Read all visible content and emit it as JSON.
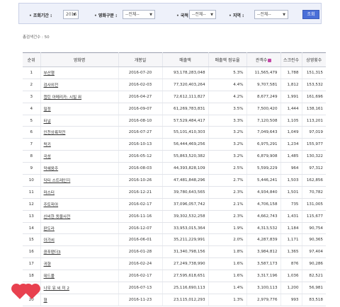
{
  "filters": {
    "period_label": "조회기간 :",
    "year_value": "2016",
    "movie_type_label": "영화구분 :",
    "movie_type_value": "--전체--",
    "country_label": "국적 :",
    "country_value": "--전체--",
    "region_label": "지역 :",
    "region_value": "--전체--",
    "search_label": "조회"
  },
  "total_text": "총검색건수 : 50",
  "table": {
    "headers": {
      "rank": "순위",
      "title": "영화명",
      "release": "개봉일",
      "sales": "매출액",
      "share": "매출액 점유율",
      "audience": "관객수",
      "screens": "스크린수",
      "shows": "상영횟수"
    },
    "rows": [
      {
        "rank": "1",
        "title": "부산행",
        "release": "2016-07-20",
        "sales": "93,178,283,048",
        "share": "5.3%",
        "audience": "11,565,479",
        "screens": "1,788",
        "shows": "151,315"
      },
      {
        "rank": "2",
        "title": "검사외전",
        "release": "2016-02-03",
        "sales": "77,320,403,264",
        "share": "4.4%",
        "audience": "9,707,581",
        "screens": "1,812",
        "shows": "153,532"
      },
      {
        "rank": "3",
        "title": "캡틴 아메리카: 시빌 워",
        "release": "2016-04-27",
        "sales": "72,612,111,827",
        "share": "4.2%",
        "audience": "8,677,249",
        "screens": "1,991",
        "shows": "161,696"
      },
      {
        "rank": "4",
        "title": "밀정",
        "release": "2016-09-07",
        "sales": "61,269,783,831",
        "share": "3.5%",
        "audience": "7,500,420",
        "screens": "1,444",
        "shows": "138,161"
      },
      {
        "rank": "5",
        "title": "터널",
        "release": "2016-08-10",
        "sales": "57,529,484,417",
        "share": "3.3%",
        "audience": "7,120,508",
        "screens": "1,105",
        "shows": "113,201"
      },
      {
        "rank": "6",
        "title": "인천상륙작전",
        "release": "2016-07-27",
        "sales": "55,101,410,303",
        "share": "3.2%",
        "audience": "7,049,643",
        "screens": "1,049",
        "shows": "97,019"
      },
      {
        "rank": "7",
        "title": "럭키",
        "release": "2016-10-13",
        "sales": "56,444,469,256",
        "share": "3.2%",
        "audience": "6,975,291",
        "screens": "1,234",
        "shows": "155,977"
      },
      {
        "rank": "8",
        "title": "곡성",
        "release": "2016-05-12",
        "sales": "55,863,520,382",
        "share": "3.2%",
        "audience": "6,879,908",
        "screens": "1,485",
        "shows": "130,322"
      },
      {
        "rank": "9",
        "title": "덕혜옹주",
        "release": "2016-08-03",
        "sales": "44,393,828,109",
        "share": "2.5%",
        "audience": "5,599,229",
        "screens": "964",
        "shows": "97,312"
      },
      {
        "rank": "10",
        "title": "닥터 스트레인지",
        "release": "2016-10-26",
        "sales": "47,481,848,296",
        "share": "2.7%",
        "audience": "5,446,241",
        "screens": "1,503",
        "shows": "162,856"
      },
      {
        "rank": "11",
        "title": "마스터",
        "release": "2016-12-21",
        "sales": "39,780,643,565",
        "share": "2.3%",
        "audience": "4,934,840",
        "screens": "1,501",
        "shows": "70,782"
      },
      {
        "rank": "12",
        "title": "주토피아",
        "release": "2016-02-17",
        "sales": "37,096,057,742",
        "share": "2.1%",
        "audience": "4,706,158",
        "screens": "735",
        "shows": "131,005"
      },
      {
        "rank": "13",
        "title": "신비한 동물사전",
        "release": "2016-11-16",
        "sales": "39,302,532,258",
        "share": "2.3%",
        "audience": "4,662,743",
        "screens": "1,431",
        "shows": "115,677"
      },
      {
        "rank": "14",
        "title": "판도라",
        "release": "2016-12-07",
        "sales": "33,953,015,364",
        "share": "1.9%",
        "audience": "4,313,532",
        "screens": "1,184",
        "shows": "90,754"
      },
      {
        "rank": "15",
        "title": "아가씨",
        "release": "2016-06-01",
        "sales": "35,211,229,991",
        "share": "2.0%",
        "audience": "4,287,839",
        "screens": "1,171",
        "shows": "90,365"
      },
      {
        "rank": "16",
        "title": "쿵푸팬더3",
        "release": "2016-01-28",
        "sales": "31,340,798,156",
        "share": "1.8%",
        "audience": "3,984,812",
        "screens": "1,365",
        "shows": "97,404"
      },
      {
        "rank": "17",
        "title": "귀향",
        "release": "2016-02-24",
        "sales": "27,249,738,990",
        "share": "1.6%",
        "audience": "3,587,173",
        "screens": "876",
        "shows": "90,286"
      },
      {
        "rank": "18",
        "title": "데드풀",
        "release": "2016-02-17",
        "sales": "27,595,618,651",
        "share": "1.6%",
        "audience": "3,317,196",
        "screens": "1,036",
        "shows": "82,521"
      },
      {
        "rank": "19",
        "title": "나우 유 씨 미 2",
        "release": "2016-07-13",
        "sales": "25,116,690,113",
        "share": "1.4%",
        "audience": "3,100,113",
        "screens": "1,200",
        "shows": "56,981"
      },
      {
        "rank": "20",
        "title": "형",
        "release": "2016-11-23",
        "sales": "23,115,012,293",
        "share": "1.3%",
        "audience": "2,979,776",
        "screens": "993",
        "shows": "83,518"
      }
    ]
  },
  "decoration": {
    "heart_color": "#e8414f"
  }
}
